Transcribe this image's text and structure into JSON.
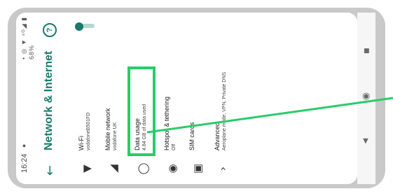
{
  "status_bar": {
    "time": "16:24",
    "indicator_dot": "●",
    "right_icons": "• ◎ ▼ ⁴ᴳ◢ ▮ 68%"
  },
  "app_bar": {
    "back_icon": "←",
    "title": "Network & Internet",
    "search_icon": "⌕",
    "help_label": "?"
  },
  "settings": [
    {
      "id": "wifi",
      "icon": "▼",
      "label": "Wi-Fi",
      "sub": "vodafoneB501FD"
    },
    {
      "id": "mobile",
      "icon": "◢",
      "label": "Mobile network",
      "sub": "vodafone UK"
    },
    {
      "id": "data",
      "icon": "◯",
      "label": "Data usage",
      "sub": "4.84 GB of data used"
    },
    {
      "id": "hotspot",
      "icon": "◉",
      "label": "Hotspot & tethering",
      "sub": "Off"
    },
    {
      "id": "sim",
      "icon": "▣",
      "label": "SIM cards",
      "sub": ""
    },
    {
      "id": "advanced",
      "icon": "›",
      "label": "Advanced",
      "sub": "Aeroplane mode, VPN, Private DNS"
    }
  ],
  "nav_buttons": {
    "recents": "■",
    "home": "◉",
    "back": "◀"
  },
  "colors": {
    "accent": "#177a6a",
    "highlight": "#29cc6a"
  }
}
